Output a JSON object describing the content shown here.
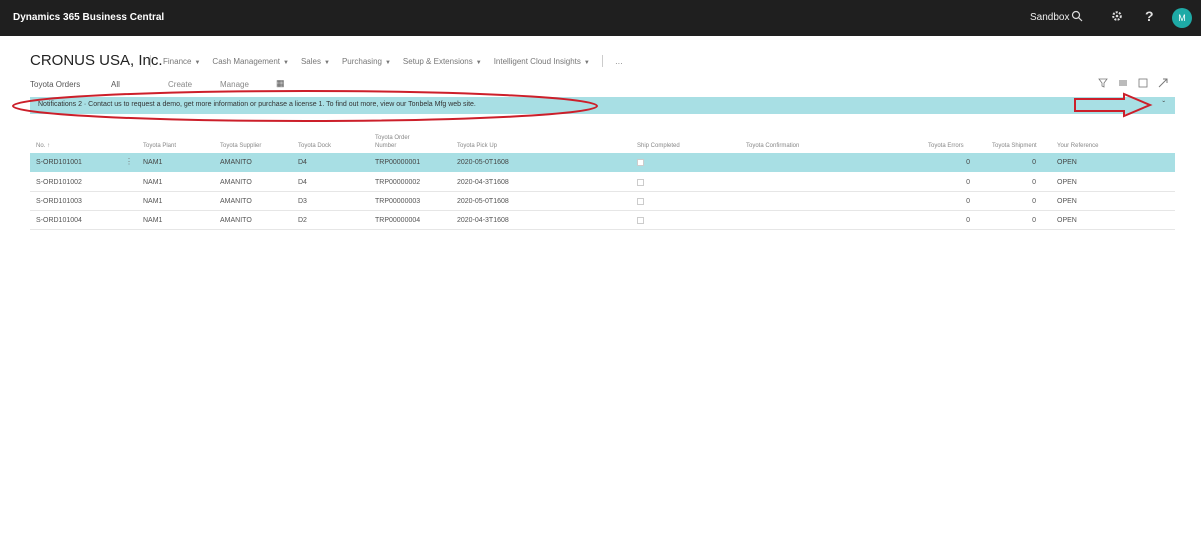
{
  "topbar": {
    "app_title": "Dynamics 365 Business Central",
    "environment": "Sandbox",
    "search_icon": "search-icon",
    "settings_icon": "gear-icon",
    "help_label": "?",
    "avatar_initials": "M"
  },
  "company": "CRONUS USA, Inc.",
  "nav": {
    "items": [
      "Finance",
      "Cash Management",
      "Sales",
      "Purchasing",
      "Setup & Extensions",
      "Intelligent Cloud Insights"
    ],
    "more": "…"
  },
  "page": {
    "title": "Toyota Orders",
    "filter": "All",
    "actions": [
      "Create",
      "Manage"
    ],
    "action_icon": "▦"
  },
  "notification": {
    "text": "Notifications 2  ·  Contact us to request a demo, get more information or purchase a license 1. To find out more, view our Tonbela Mfg web site.",
    "chevron": "ˇ"
  },
  "table": {
    "headers": [
      "No. ↑",
      "Toyota Plant",
      "Toyota Supplier",
      "Toyota Dock",
      "Toyota Order Number",
      "Toyota Pick Up",
      "Ship Completed",
      "Toyota Confirmation",
      "Toyota Errors",
      "Toyota Shipment",
      "Your Reference"
    ],
    "rows": [
      [
        "S-ORD101001",
        "NAM1",
        "AMANITO",
        "D4",
        "TRP00000001",
        "2020-05-0T1608",
        "",
        "",
        "0",
        "0",
        "OPEN"
      ],
      [
        "S-ORD101002",
        "NAM1",
        "AMANITO",
        "D4",
        "TRP00000002",
        "2020-04-3T1608",
        "",
        "",
        "0",
        "0",
        "OPEN"
      ],
      [
        "S-ORD101003",
        "NAM1",
        "AMANITO",
        "D3",
        "TRP00000003",
        "2020-05-0T1608",
        "",
        "",
        "0",
        "0",
        "OPEN"
      ],
      [
        "S-ORD101004",
        "NAM1",
        "AMANITO",
        "D2",
        "TRP00000004",
        "2020-04-3T1608",
        "",
        "",
        "0",
        "0",
        "OPEN"
      ]
    ],
    "selected_row": 0
  },
  "colors": {
    "topbar": "#1f1f1f",
    "accent": "#a8dfe4",
    "annotation": "#cc1f2a",
    "avatar": "#1eaaa6"
  }
}
